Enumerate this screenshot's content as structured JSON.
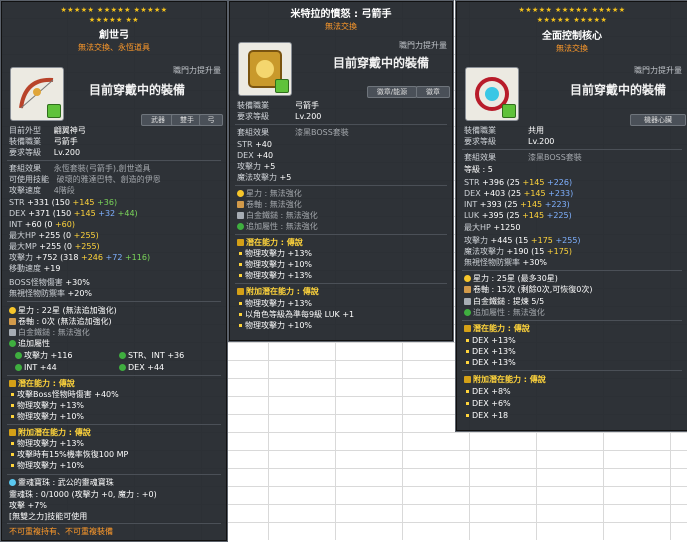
{
  "p1": {
    "stars_row1": "★★★★★ ★★★★★ ★★★★★",
    "stars_row2": "★★★★★ ★★",
    "title": "創世弓",
    "subtitle": "無法交換、永恆道具",
    "job_tag": "職門力提升量",
    "wearing": "目前穿戴中的裝備",
    "buttons": [
      "武器",
      "雙手",
      "弓"
    ],
    "info": [
      {
        "k": "目前外型",
        "v": "翩翼神弓"
      },
      {
        "k": "裝備職業",
        "v": "弓箭手"
      },
      {
        "k": "要求等級",
        "v": "Lv.200"
      }
    ],
    "set_label": "套組效果",
    "set_value": "永恆套裝(弓箭手),創世道具",
    "skill_label": "可使用技能",
    "skill_value": "破壞的雅達巴特、創造的伊恩",
    "speed_label": "攻擊速度",
    "speed_value": "4階段",
    "stats": [
      {
        "k": "STR",
        "base": "+331 (150",
        "a": "+145",
        "b": "+36)"
      },
      {
        "k": "DEX",
        "base": "+371 (150",
        "a": "+145",
        "b": "+32",
        "c": "+44)"
      },
      {
        "k": "INT",
        "base": "+60 (0",
        "a": "+60)"
      },
      {
        "k": "最大HP",
        "base": "+255 (0",
        "a": "+255)"
      },
      {
        "k": "最大MP",
        "base": "+255 (0",
        "a": "+255)"
      },
      {
        "k": "攻擊力",
        "base": "+752 (318",
        "a": "+246",
        "b": "+72",
        "c": "+116)"
      },
      {
        "k": "移動速度",
        "base": "+19"
      },
      {
        "k": "BOSS怪物傷害",
        "base": "+30%"
      },
      {
        "k": "無視怪物防禦率",
        "base": "+20%"
      }
    ],
    "star_force": "星力 : 22星 (無法追加強化)",
    "scroll": "卷軸 : 0次 (無法追加強化)",
    "hammer": "白金鐵鎚 : 無法強化",
    "extra_title": "追加屬性",
    "extra": [
      {
        "k": "攻擊力",
        "v": "+116"
      },
      {
        "k": "STR、INT",
        "v": "+36"
      },
      {
        "k": "INT",
        "v": "+44"
      },
      {
        "k": "DEX",
        "v": "+44"
      }
    ],
    "potential_title": "潛在能力 : 傳說",
    "potential": [
      "攻擊Boss怪物時傷害 +40%",
      "物理攻擊力 +13%",
      "物理攻擊力 +10%"
    ],
    "add_potential_title": "附加潛在能力 : 傳說",
    "add_potential": [
      "物理攻擊力 +13%",
      "攻擊時有15%機率恢復100 MP",
      "物理攻擊力 +10%"
    ],
    "soul_line": "靈魂寶珠 : 武公的靈魂寶珠",
    "soul_charge": "靈魂珠 : 0/1000 (攻擊力 +0, 魔力 : +0)",
    "soul_atk": "攻擊 +7%",
    "soul_skill": "[無雙之力]技能可使用",
    "footer": "不可重複持有、不可重複裝備"
  },
  "p2": {
    "title": "米特拉的憤怒 : 弓箭手",
    "subtitle": "無法交換",
    "job_tag": "職門力提升量",
    "wearing": "目前穿戴中的裝備",
    "buttons": [
      "徽章/能源",
      "徽章"
    ],
    "info": [
      {
        "k": "裝備職業",
        "v": "弓箭手"
      },
      {
        "k": "要求等級",
        "v": "Lv.200"
      }
    ],
    "set_label": "套組效果",
    "set_value": "漆黑BOSS套裝",
    "stats": [
      {
        "k": "STR",
        "v": "+40"
      },
      {
        "k": "DEX",
        "v": "+40"
      },
      {
        "k": "攻擊力",
        "v": "+5"
      },
      {
        "k": "魔法攻擊力",
        "v": "+5"
      }
    ],
    "star_force": "星力 : 無法強化",
    "scroll": "卷軸 : 無法強化",
    "hammer": "白金鐵鎚 : 無法強化",
    "extra": "追加屬性 : 無法強化",
    "potential_title": "潛在能力 : 傳說",
    "potential": [
      "物理攻擊力 +13%",
      "物理攻擊力 +10%",
      "物理攻擊力 +13%"
    ],
    "add_potential_title": "附加潛在能力 : 傳說",
    "add_potential": [
      "物理攻擊力 +13%",
      "以角色等級為準每9級 LUK +1",
      "物理攻擊力 +10%"
    ]
  },
  "p3": {
    "stars_row1": "★★★★★ ★★★★★ ★★★★★",
    "stars_row2": "★★★★★ ★★★★★",
    "title": "全面控制核心",
    "subtitle": "無法交換",
    "job_tag": "職門力提升量",
    "wearing": "目前穿戴中的裝備",
    "buttons": [
      "機器心臟"
    ],
    "info": [
      {
        "k": "裝備職業",
        "v": "共用"
      },
      {
        "k": "要求等級",
        "v": "Lv.200"
      }
    ],
    "set_label": "套組效果",
    "set_value": "漆黑BOSS套裝",
    "level": "等級 : 5",
    "stats": [
      {
        "k": "STR",
        "base": "+396 (25",
        "a": "+145",
        "b": "+226)"
      },
      {
        "k": "DEX",
        "base": "+403 (25",
        "a": "+145",
        "b": "+233)"
      },
      {
        "k": "INT",
        "base": "+393 (25",
        "a": "+145",
        "b": "+223)"
      },
      {
        "k": "LUK",
        "base": "+395 (25",
        "a": "+145",
        "b": "+225)"
      },
      {
        "k": "最大HP",
        "base": "+1250"
      },
      {
        "k": "攻擊力",
        "base": "+445 (15",
        "a": "+175",
        "b": "+255)"
      },
      {
        "k": "魔法攻擊力",
        "base": "+190 (15",
        "a": "+175)"
      },
      {
        "k": "無視怪物防禦率",
        "base": "+30%"
      }
    ],
    "star_force": "星力 : 25星 (最多30星)",
    "scroll": "卷軸 : 15次 (剩餘0次,可恢復0次)",
    "hammer": "白金鐵鎚 : 提煉 5/5",
    "extra": "追加屬性 : 無法強化",
    "potential_title": "潛在能力 : 傳說",
    "potential": [
      "DEX +13%",
      "DEX +13%",
      "DEX +13%"
    ],
    "add_potential_title": "附加潛在能力 : 傳說",
    "add_potential": [
      "DEX +8%",
      "DEX +6%",
      "DEX +18"
    ]
  },
  "colors": {
    "gold": "#ffd43b",
    "green": "#7bd65a",
    "blue": "#7fb1ff",
    "orange": "#ff9a2a",
    "red": "#ff5a5a"
  }
}
